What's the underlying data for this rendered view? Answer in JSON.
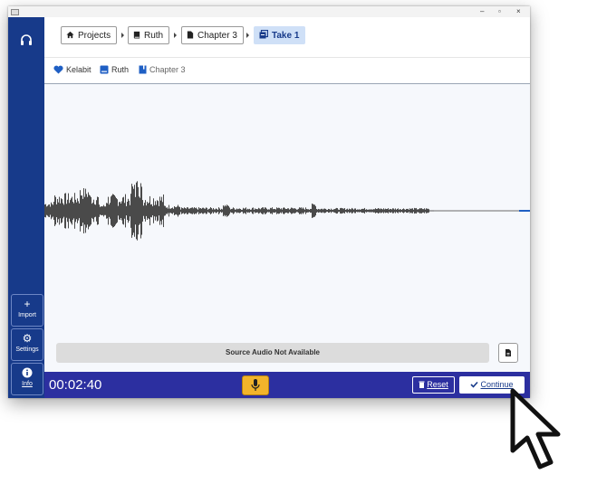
{
  "window": {
    "controls": {
      "minimize": "–",
      "maximize": "▫",
      "close": "×"
    }
  },
  "sidebar": {
    "top_icon": "headphones-icon",
    "buttons": [
      {
        "label": "Import",
        "icon": "plus-icon",
        "glyph": "+"
      },
      {
        "label": "Settings",
        "icon": "gear-icon",
        "glyph": "⚙"
      },
      {
        "label": "Info",
        "icon": "info-icon",
        "glyph": "i"
      }
    ]
  },
  "breadcrumbs": [
    {
      "label": "Projects",
      "icon": "home-icon"
    },
    {
      "label": "Ruth",
      "icon": "book-icon"
    },
    {
      "label": "Chapter 3",
      "icon": "page-icon"
    },
    {
      "label": "Take 1",
      "icon": "take-icon",
      "active": true
    }
  ],
  "info": {
    "language": "Kelabit",
    "book": "Ruth",
    "chapter": "Chapter 3"
  },
  "source_audio": {
    "label": "Source Audio Not Available"
  },
  "bottom": {
    "timer": "00:02:40",
    "reset_label": "Reset",
    "continue_label": "Continue"
  },
  "colors": {
    "sidebar": "#173a8a",
    "bottombar": "#2c2fa0",
    "mic": "#f2b42b",
    "active_crumb": "#cfe0f7"
  }
}
